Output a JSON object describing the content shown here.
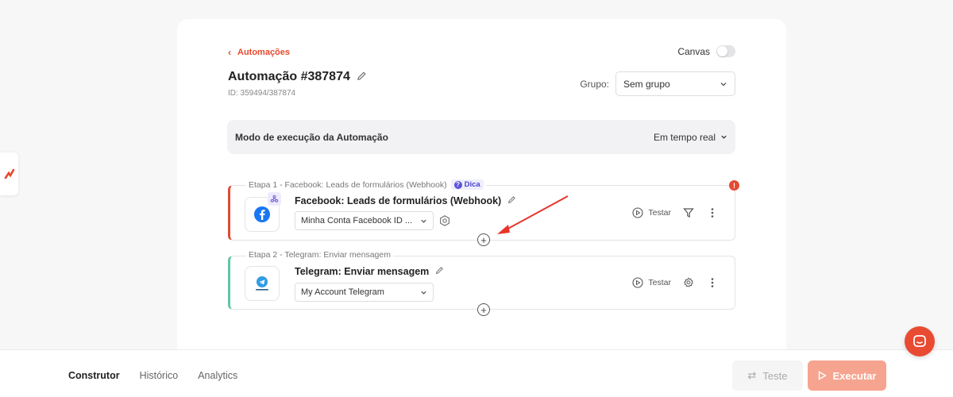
{
  "nav": {
    "back_label": "Automações"
  },
  "canvas": {
    "label": "Canvas",
    "enabled": false
  },
  "automation": {
    "title": "Automação #387874",
    "id_text": "ID: 359494/387874"
  },
  "group": {
    "label": "Grupo:",
    "value": "Sem grupo"
  },
  "execution_mode": {
    "label": "Modo de execução da Automação",
    "value": "Em tempo real"
  },
  "steps": [
    {
      "label": "Etapa 1 - Facebook: Leads de formulários (Webhook)",
      "tip": "Dica",
      "name": "Facebook: Leads de formulários (Webhook)",
      "account": "Minha Conta Facebook ID ...",
      "test_label": "Testar",
      "icon": "facebook-icon",
      "accent_color": "#e24a36"
    },
    {
      "label": "Etapa 2 - Telegram: Enviar mensagem",
      "name": "Telegram: Enviar mensagem",
      "account": "My Account Telegram",
      "test_label": "Testar",
      "icon": "telegram-icon",
      "accent_color": "#5ec6a8"
    }
  ],
  "footer": {
    "tabs": [
      "Construtor",
      "Histórico",
      "Analytics"
    ],
    "active_tab": "Construtor",
    "test_button": "Teste",
    "execute_button": "Executar"
  },
  "colors": {
    "brand": "#e8492e",
    "execute_disabled": "#f6a48f"
  }
}
